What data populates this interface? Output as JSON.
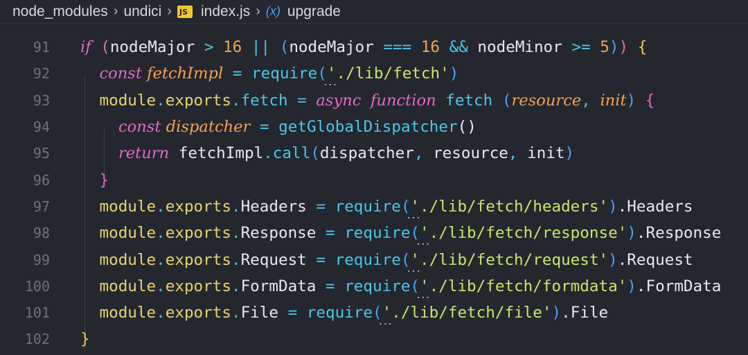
{
  "breadcrumb": {
    "items": [
      "node_modules",
      "undici",
      "index.js",
      "upgrade"
    ],
    "file_icon": "JS",
    "symbol_icon": "(x)"
  },
  "editor": {
    "lines": [
      {
        "num": "91",
        "tokens": [
          {
            "t": "if",
            "c": "t-ctrl"
          },
          {
            "t": " ",
            "c": ""
          },
          {
            "t": "(",
            "c": "t-paren1"
          },
          {
            "t": "nodeMajor",
            "c": "t-ident"
          },
          {
            "t": " > ",
            "c": "t-op"
          },
          {
            "t": "16",
            "c": "t-num"
          },
          {
            "t": " || ",
            "c": "t-op"
          },
          {
            "t": "(",
            "c": "t-paren2"
          },
          {
            "t": "nodeMajor",
            "c": "t-ident"
          },
          {
            "t": " === ",
            "c": "t-op"
          },
          {
            "t": "16",
            "c": "t-num"
          },
          {
            "t": " && ",
            "c": "t-op"
          },
          {
            "t": "nodeMinor",
            "c": "t-ident"
          },
          {
            "t": " >= ",
            "c": "t-op"
          },
          {
            "t": "5",
            "c": "t-num"
          },
          {
            "t": ")",
            "c": "t-paren2"
          },
          {
            "t": ")",
            "c": "t-paren1"
          },
          {
            "t": " ",
            "c": ""
          },
          {
            "t": "{",
            "c": "t-brace"
          }
        ]
      },
      {
        "num": "92",
        "tokens": [
          {
            "t": "const",
            "c": "t-kw"
          },
          {
            "t": " fetchImpl",
            "c": "t-param"
          },
          {
            "t": " = ",
            "c": "t-op"
          },
          {
            "t": "require",
            "c": "t-fn"
          },
          {
            "t": "(",
            "c": "t-paren2"
          },
          {
            "t": "'",
            "c": "t-str"
          },
          {
            "t": "./lib/fetch'",
            "c": "t-str"
          },
          {
            "t": ")",
            "c": "t-paren2"
          }
        ]
      },
      {
        "num": "93",
        "tokens": [
          {
            "t": "module",
            "c": "t-mod"
          },
          {
            "t": ".",
            "c": "t-punc"
          },
          {
            "t": "exports",
            "c": "t-mod"
          },
          {
            "t": ".",
            "c": "t-punc"
          },
          {
            "t": "fetch",
            "c": "t-fn"
          },
          {
            "t": " = ",
            "c": "t-op"
          },
          {
            "t": "async",
            "c": "t-kw"
          },
          {
            "t": " ",
            "c": ""
          },
          {
            "t": "function",
            "c": "t-kw"
          },
          {
            "t": " fetch ",
            "c": "t-fn"
          },
          {
            "t": "(",
            "c": "t-paren2"
          },
          {
            "t": "resource",
            "c": "t-param"
          },
          {
            "t": ", ",
            "c": "t-punc"
          },
          {
            "t": "init",
            "c": "t-param"
          },
          {
            "t": ")",
            "c": "t-paren2"
          },
          {
            "t": " ",
            "c": ""
          },
          {
            "t": "{",
            "c": "t-paren1"
          }
        ]
      },
      {
        "num": "94",
        "tokens": [
          {
            "t": "const",
            "c": "t-kw"
          },
          {
            "t": " dispatcher",
            "c": "t-param"
          },
          {
            "t": " = ",
            "c": "t-op"
          },
          {
            "t": "getGlobalDispatcher",
            "c": "t-fn"
          },
          {
            "t": "()",
            "c": "t-ident"
          }
        ]
      },
      {
        "num": "95",
        "tokens": [
          {
            "t": "return",
            "c": "t-ctrl"
          },
          {
            "t": " fetchImpl",
            "c": "t-ident"
          },
          {
            "t": ".",
            "c": "t-punc"
          },
          {
            "t": "call",
            "c": "t-fn"
          },
          {
            "t": "(",
            "c": "t-paren2"
          },
          {
            "t": "dispatcher",
            "c": "t-ident"
          },
          {
            "t": ", ",
            "c": "t-punc"
          },
          {
            "t": "resource",
            "c": "t-ident"
          },
          {
            "t": ", ",
            "c": "t-punc"
          },
          {
            "t": "init",
            "c": "t-ident"
          },
          {
            "t": ")",
            "c": "t-paren2"
          }
        ]
      },
      {
        "num": "96",
        "tokens": [
          {
            "t": "}",
            "c": "t-paren1"
          }
        ]
      },
      {
        "num": "97",
        "tokens": [
          {
            "t": "module",
            "c": "t-mod"
          },
          {
            "t": ".",
            "c": "t-punc"
          },
          {
            "t": "exports",
            "c": "t-mod"
          },
          {
            "t": ".",
            "c": "t-punc"
          },
          {
            "t": "Headers",
            "c": "t-prop"
          },
          {
            "t": " = ",
            "c": "t-op"
          },
          {
            "t": "require",
            "c": "t-fn"
          },
          {
            "t": "(",
            "c": "t-paren2"
          },
          {
            "t": "'",
            "c": "t-str"
          },
          {
            "t": "./lib/fetch/headers'",
            "c": "t-str"
          },
          {
            "t": ")",
            "c": "t-paren2"
          },
          {
            "t": ".Headers",
            "c": "t-prop"
          }
        ]
      },
      {
        "num": "98",
        "tokens": [
          {
            "t": "module",
            "c": "t-mod"
          },
          {
            "t": ".",
            "c": "t-punc"
          },
          {
            "t": "exports",
            "c": "t-mod"
          },
          {
            "t": ".",
            "c": "t-punc"
          },
          {
            "t": "Response",
            "c": "t-prop"
          },
          {
            "t": " = ",
            "c": "t-op"
          },
          {
            "t": "require",
            "c": "t-fn"
          },
          {
            "t": "(",
            "c": "t-paren2"
          },
          {
            "t": "'",
            "c": "t-str"
          },
          {
            "t": "./lib/fetch/response'",
            "c": "t-str"
          },
          {
            "t": ")",
            "c": "t-paren2"
          },
          {
            "t": ".Response",
            "c": "t-prop"
          }
        ]
      },
      {
        "num": "99",
        "tokens": [
          {
            "t": "module",
            "c": "t-mod"
          },
          {
            "t": ".",
            "c": "t-punc"
          },
          {
            "t": "exports",
            "c": "t-mod"
          },
          {
            "t": ".",
            "c": "t-punc"
          },
          {
            "t": "Request",
            "c": "t-prop"
          },
          {
            "t": " = ",
            "c": "t-op"
          },
          {
            "t": "require",
            "c": "t-fn"
          },
          {
            "t": "(",
            "c": "t-paren2"
          },
          {
            "t": "'",
            "c": "t-str"
          },
          {
            "t": "./lib/fetch/request'",
            "c": "t-str"
          },
          {
            "t": ")",
            "c": "t-paren2"
          },
          {
            "t": ".Request",
            "c": "t-prop"
          }
        ]
      },
      {
        "num": "100",
        "tokens": [
          {
            "t": "module",
            "c": "t-mod"
          },
          {
            "t": ".",
            "c": "t-punc"
          },
          {
            "t": "exports",
            "c": "t-mod"
          },
          {
            "t": ".",
            "c": "t-punc"
          },
          {
            "t": "FormData",
            "c": "t-prop"
          },
          {
            "t": " = ",
            "c": "t-op"
          },
          {
            "t": "require",
            "c": "t-fn"
          },
          {
            "t": "(",
            "c": "t-paren2"
          },
          {
            "t": "'",
            "c": "t-str"
          },
          {
            "t": "./lib/fetch/formdata'",
            "c": "t-str"
          },
          {
            "t": ")",
            "c": "t-paren2"
          },
          {
            "t": ".FormData",
            "c": "t-prop"
          }
        ]
      },
      {
        "num": "101",
        "tokens": [
          {
            "t": "module",
            "c": "t-mod"
          },
          {
            "t": ".",
            "c": "t-punc"
          },
          {
            "t": "exports",
            "c": "t-mod"
          },
          {
            "t": ".",
            "c": "t-punc"
          },
          {
            "t": "File",
            "c": "t-prop"
          },
          {
            "t": " = ",
            "c": "t-op"
          },
          {
            "t": "require",
            "c": "t-fn"
          },
          {
            "t": "(",
            "c": "t-paren2"
          },
          {
            "t": "'",
            "c": "t-str"
          },
          {
            "t": "./lib/fetch/file'",
            "c": "t-str"
          },
          {
            "t": ")",
            "c": "t-paren2"
          },
          {
            "t": ".File",
            "c": "t-prop"
          }
        ]
      },
      {
        "num": "102",
        "tokens": [
          {
            "t": "}",
            "c": "t-brace"
          }
        ]
      }
    ]
  }
}
